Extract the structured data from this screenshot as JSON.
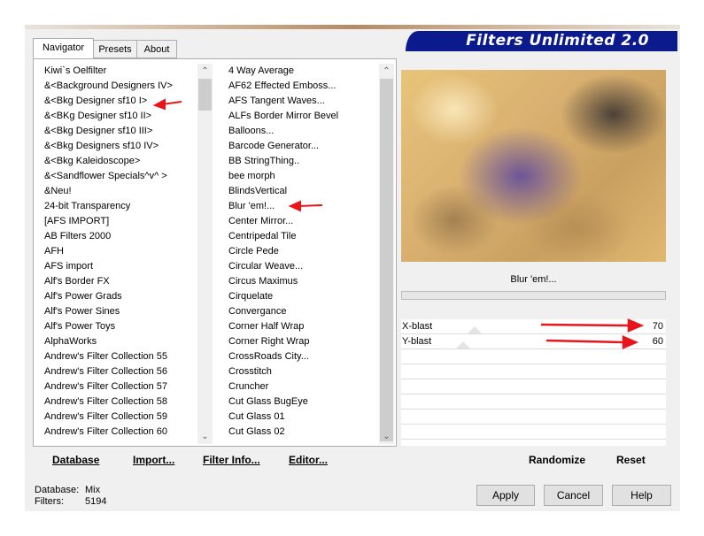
{
  "banner": {
    "title": "Filters Unlimited 2.0"
  },
  "tabs": [
    {
      "label": "Navigator",
      "active": true
    },
    {
      "label": "Presets",
      "active": false
    },
    {
      "label": "About",
      "active": false
    }
  ],
  "categories": [
    "Kiwi`s Oelfilter",
    "&<Background Designers IV>",
    "&<Bkg Designer sf10 I>",
    "&<BKg Designer sf10 II>",
    "&<Bkg Designer sf10 III>",
    "&<Bkg Designers sf10 IV>",
    "&<Bkg Kaleidoscope>",
    "&<Sandflower Specials^v^ >",
    "&Neu!",
    "24-bit Transparency",
    "[AFS IMPORT]",
    "AB Filters 2000",
    "AFH",
    "AFS import",
    "Alf's Border FX",
    "Alf's Power Grads",
    "Alf's Power Sines",
    "Alf's Power Toys",
    "AlphaWorks",
    "Andrew's Filter Collection 55",
    "Andrew's Filter Collection 56",
    "Andrew's Filter Collection 57",
    "Andrew's Filter Collection 58",
    "Andrew's Filter Collection 59",
    "Andrew's Filter Collection 60"
  ],
  "filters": [
    "4 Way Average",
    "AF62 Effected Emboss...",
    "AFS Tangent Waves...",
    "ALFs Border Mirror Bevel",
    "Balloons...",
    "Barcode Generator...",
    "BB StringThing..",
    "bee morph",
    "BlindsVertical",
    "Blur 'em!...",
    "Center Mirror...",
    "Centripedal Tile",
    "Circle Pede",
    "Circular Weave...",
    "Circus Maximus",
    "Cirquelate",
    "Convergance",
    "Corner Half Wrap",
    "Corner Right Wrap",
    "CrossRoads City...",
    "Crosstitch",
    "Cruncher",
    "Cut Glass  BugEye",
    "Cut Glass 01",
    "Cut Glass 02"
  ],
  "selected_filter": "Blur 'em!...",
  "params": [
    {
      "label": "X-blast",
      "value": "70"
    },
    {
      "label": "Y-blast",
      "value": "60"
    }
  ],
  "toolbar": {
    "database_label": "Database",
    "import_label": "Import...",
    "filterinfo_label": "Filter Info...",
    "editor_label": "Editor...",
    "randomize_label": "Randomize",
    "reset_label": "Reset"
  },
  "buttons": {
    "apply": "Apply",
    "cancel": "Cancel",
    "help": "Help"
  },
  "status": {
    "database_label": "Database:",
    "database_value": "Mix",
    "filters_label": "Filters:",
    "filters_value": "5194"
  },
  "colors": {
    "banner": "#0b1a8c",
    "annotation_arrow": "#e8151a"
  }
}
